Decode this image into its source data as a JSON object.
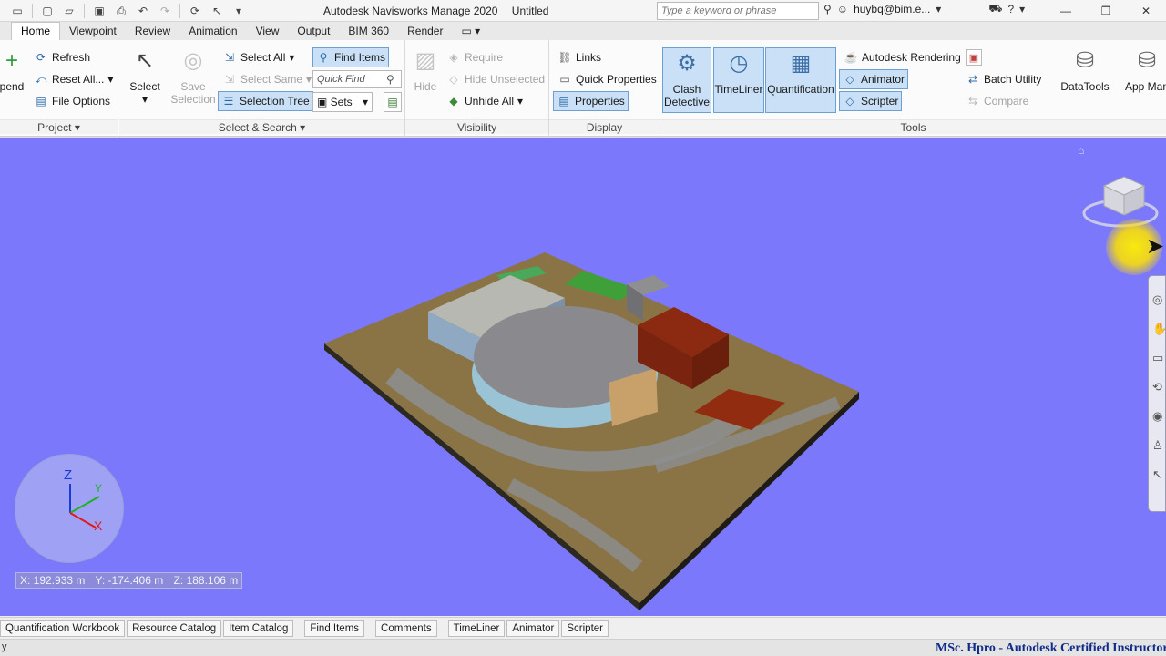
{
  "app": {
    "title": "Autodesk Navisworks Manage 2020",
    "document": "Untitled",
    "search_placeholder": "Type a keyword or phrase",
    "user": "huybq@bim.e..."
  },
  "tabs": [
    "Home",
    "Viewpoint",
    "Review",
    "Animation",
    "View",
    "Output",
    "BIM 360",
    "Render"
  ],
  "ribbon": {
    "project": {
      "label": "Project",
      "append": "pend",
      "refresh": "Refresh",
      "reset_all": "Reset All...",
      "file_options": "File Options"
    },
    "select_search": {
      "label": "Select & Search",
      "select": "Select",
      "save_selection_1": "Save",
      "save_selection_2": "Selection",
      "select_all": "Select All",
      "select_same": "Select Same",
      "selection_tree": "Selection Tree",
      "find_items": "Find Items",
      "quick_find_placeholder": "Quick Find",
      "sets": "Sets"
    },
    "visibility": {
      "label": "Visibility",
      "hide": "Hide",
      "require": "Require",
      "hide_unselected": "Hide Unselected",
      "unhide_all": "Unhide All"
    },
    "display": {
      "label": "Display",
      "links": "Links",
      "quick_properties": "Quick Properties",
      "properties": "Properties"
    },
    "tools": {
      "label": "Tools",
      "clash_detective_1": "Clash",
      "clash_detective_2": "Detective",
      "timeliner": "TimeLiner",
      "quantification": "Quantification",
      "autodesk_rendering": "Autodesk Rendering",
      "animator": "Animator",
      "scripter": "Scripter",
      "batch_utility": "Batch Utility",
      "compare": "Compare",
      "datatools": "DataTools",
      "app_manager": "App Man"
    }
  },
  "viewport": {
    "axes": {
      "z": "Z",
      "y": "Y",
      "x": "X"
    },
    "coords": {
      "x": "X: 192.933 m",
      "y": "Y: -174.406 m",
      "z": "Z: 188.106 m"
    },
    "background": "#7b78fb"
  },
  "bottom_tabs": [
    "Quantification Workbook",
    "Resource Catalog",
    "Item Catalog",
    "Find Items",
    "Comments",
    "TimeLiner",
    "Animator",
    "Scripter"
  ],
  "status": {
    "left": "y",
    "watermark": "MSc. Hpro - Autodesk Certified Instructor"
  }
}
